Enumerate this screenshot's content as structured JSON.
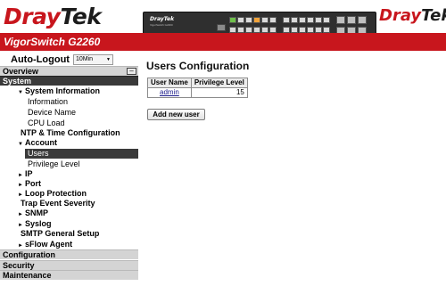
{
  "header": {
    "brand_dray": "Dray",
    "brand_tek": "Tek",
    "model": "VigorSwitch G2260",
    "device_label_dray": "Dray",
    "device_label_tek": "Tek",
    "device_sub": "VigorSwitch G2260"
  },
  "sidebar": {
    "autologout_label": "Auto-Logout",
    "autologout_value": "10Min",
    "overview_label": "Overview",
    "system_label": "System",
    "items": [
      {
        "label": "System Information",
        "arrow": "▼"
      },
      {
        "label": "Information"
      },
      {
        "label": "Device Name"
      },
      {
        "label": "CPU Load"
      },
      {
        "label": "NTP & Time Configuration"
      },
      {
        "label": "Account",
        "arrow": "▼"
      },
      {
        "label": "Users"
      },
      {
        "label": "Privilege Level"
      },
      {
        "label": "IP",
        "arrow": "►"
      },
      {
        "label": "Port",
        "arrow": "►"
      },
      {
        "label": "Loop Protection",
        "arrow": "►"
      },
      {
        "label": "Trap Event Severity"
      },
      {
        "label": "SNMP",
        "arrow": "►"
      },
      {
        "label": "Syslog",
        "arrow": "►"
      },
      {
        "label": "SMTP General Setup"
      },
      {
        "label": "sFlow Agent",
        "arrow": "►"
      }
    ],
    "sections": [
      "Configuration",
      "Security",
      "Maintenance"
    ]
  },
  "main": {
    "title": "Users Configuration",
    "table": {
      "headers": [
        "User Name",
        "Privilege Level"
      ],
      "rows": [
        {
          "name": "admin",
          "level": "15"
        }
      ]
    },
    "add_button_label": "Add new user"
  }
}
